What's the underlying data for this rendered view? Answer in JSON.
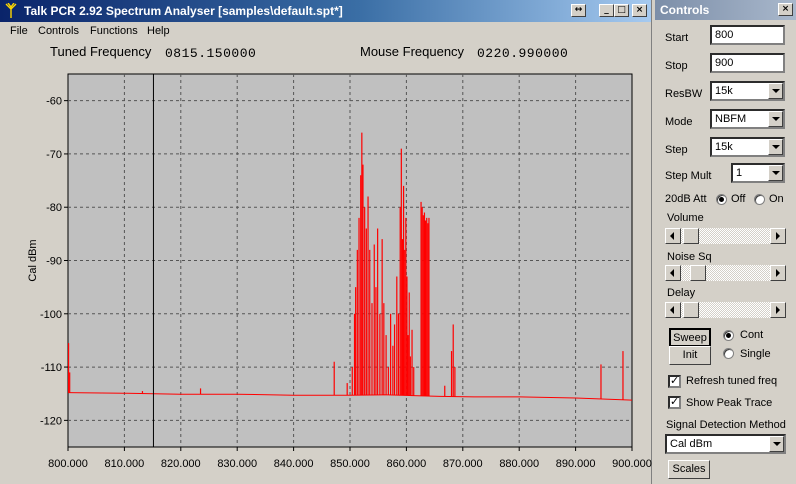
{
  "window": {
    "title": "Talk PCR 2.92 Spectrum Analyser [samples\\default.spt*]",
    "buttons": {
      "restore": "↔",
      "minimize": "_",
      "maximize": "□",
      "close": "×"
    }
  },
  "menu": [
    "File",
    "Controls",
    "Functions",
    "Help"
  ],
  "readout": {
    "tuned_label": "Tuned Frequency",
    "tuned_value": "0815.150000",
    "mouse_label": "Mouse Frequency",
    "mouse_value": "0220.990000"
  },
  "chart_data": {
    "type": "line",
    "title": "",
    "xlabel": "",
    "ylabel": "Cal dBm",
    "xlim": [
      800,
      900
    ],
    "ylim": [
      -125,
      -55
    ],
    "x_ticks": [
      "800.000",
      "810.000",
      "820.000",
      "830.000",
      "840.000",
      "850.000",
      "860.000",
      "870.000",
      "880.000",
      "890.000",
      "900.000"
    ],
    "y_ticks": [
      "-60",
      "-70",
      "-80",
      "-90",
      "-100",
      "-110",
      "-120"
    ],
    "grid": true,
    "grid_style": "dashed",
    "background": "#c0c0c0",
    "line_color": "#ff0000",
    "cursor_x": 815.15,
    "baseline": [
      [
        800.0,
        -114.8
      ],
      [
        810.0,
        -114.9
      ],
      [
        820.0,
        -115.1
      ],
      [
        830.0,
        -115.1
      ],
      [
        840.0,
        -115.3
      ],
      [
        850.0,
        -115.3
      ],
      [
        856.0,
        -115.2
      ],
      [
        862.0,
        -115.4
      ],
      [
        866.0,
        -115.5
      ],
      [
        872.0,
        -115.6
      ],
      [
        880.0,
        -115.6
      ],
      [
        890.0,
        -115.8
      ],
      [
        900.0,
        -116.2
      ]
    ],
    "spikes": [
      [
        800.1,
        -105.5
      ],
      [
        800.3,
        -111.0
      ],
      [
        813.2,
        -114.5
      ],
      [
        823.5,
        -114.0
      ],
      [
        847.2,
        -109.0
      ],
      [
        849.5,
        -113.0
      ],
      [
        850.4,
        -110.0
      ],
      [
        850.8,
        -100.0
      ],
      [
        851.0,
        -95.0
      ],
      [
        851.3,
        -88.0
      ],
      [
        851.6,
        -82.0
      ],
      [
        851.9,
        -74.0
      ],
      [
        852.1,
        -66.0
      ],
      [
        852.3,
        -72.0
      ],
      [
        852.6,
        -80.0
      ],
      [
        852.9,
        -84.0
      ],
      [
        853.2,
        -78.0
      ],
      [
        853.5,
        -88.0
      ],
      [
        853.9,
        -98.0
      ],
      [
        854.3,
        -87.0
      ],
      [
        854.6,
        -95.0
      ],
      [
        854.9,
        -84.0
      ],
      [
        855.3,
        -100.0
      ],
      [
        855.7,
        -86.0
      ],
      [
        856.0,
        -98.0
      ],
      [
        856.4,
        -104.0
      ],
      [
        856.8,
        -110.0
      ],
      [
        857.2,
        -100.0
      ],
      [
        857.6,
        -106.0
      ],
      [
        857.9,
        -102.0
      ],
      [
        858.3,
        -93.0
      ],
      [
        858.6,
        -100.0
      ],
      [
        858.9,
        -80.0
      ],
      [
        859.1,
        -69.0
      ],
      [
        859.3,
        -86.0
      ],
      [
        859.5,
        -76.0
      ],
      [
        859.7,
        -88.0
      ],
      [
        859.9,
        -82.0
      ],
      [
        860.1,
        -93.0
      ],
      [
        860.3,
        -104.0
      ],
      [
        860.5,
        -96.0
      ],
      [
        860.7,
        -108.0
      ],
      [
        861.0,
        -103.0
      ],
      [
        861.3,
        -110.0
      ],
      [
        862.6,
        -79.0
      ],
      [
        862.8,
        -80.0
      ],
      [
        863.0,
        -81.5
      ],
      [
        863.2,
        -81.0
      ],
      [
        863.4,
        -82.5
      ],
      [
        863.6,
        -82.0
      ],
      [
        863.8,
        -83.0
      ],
      [
        864.0,
        -82.0
      ],
      [
        866.8,
        -113.5
      ],
      [
        868.0,
        -107.0
      ],
      [
        868.3,
        -102.0
      ],
      [
        868.6,
        -110.0
      ],
      [
        894.5,
        -109.5
      ],
      [
        898.4,
        -107.0
      ]
    ]
  },
  "controls": {
    "title": "Controls",
    "start_label": "Start",
    "start_value": "800",
    "stop_label": "Stop",
    "stop_value": "900",
    "resbw_label": "ResBW",
    "resbw_value": "15k",
    "mode_label": "Mode",
    "mode_value": "NBFM",
    "step_label": "Step",
    "step_value": "15k",
    "stepmult_label": "Step Mult",
    "stepmult_value": "1",
    "att_label": "20dB Att",
    "att_off": "Off",
    "att_on": "On",
    "att_selected": "Off",
    "volume_label": "Volume",
    "volume_level": 0.03,
    "noisesq_label": "Noise Sq",
    "noisesq_level": 0.08,
    "delay_label": "Delay",
    "delay_level": 0.03,
    "sweep_label": "Sweep",
    "init_label": "Init",
    "cont_label": "Cont",
    "single_label": "Single",
    "sweep_selected": "Cont",
    "refresh_label": "Refresh tuned freq",
    "peak_label": "Show Peak Trace",
    "signal_method_label": "Signal Detection Method",
    "signal_method_value": "Cal dBm",
    "scales_label": "Scales"
  }
}
